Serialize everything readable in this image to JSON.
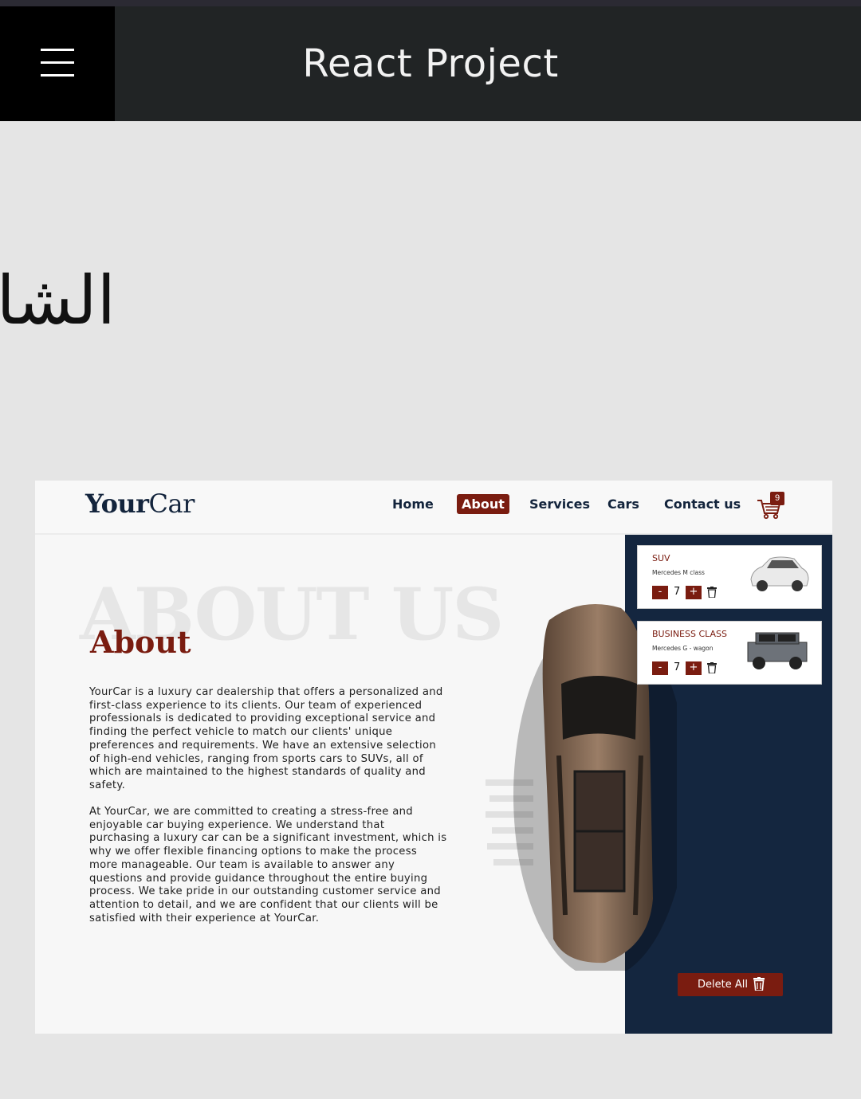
{
  "app": {
    "title": "React Project"
  },
  "arabic_text": "الشا",
  "site": {
    "brand_bold": "Your",
    "brand_regular": "Car",
    "nav": [
      "Home",
      "About",
      "Services",
      "Cars",
      "Contact us"
    ],
    "active_nav": "About",
    "cart_count": "9",
    "ghost_heading": "ABOUT US",
    "heading": "About",
    "paragraph1": "YourCar is a luxury car dealership that offers a personalized and first-class experience to its clients. Our team of experienced professionals is dedicated to providing exceptional service and finding the perfect vehicle to match our clients' unique preferences and requirements. We have an extensive selection of high-end vehicles, ranging from sports cars to SUVs, all of which are maintained to the highest standards of quality and safety.",
    "paragraph2": "At YourCar, we are committed to creating a stress-free and enjoyable car buying experience. We understand that purchasing a luxury car can be a significant investment, which is why we offer flexible financing options to make the process more manageable. Our team is available to answer any questions and provide guidance throughout the entire buying process. We take pride in our outstanding customer service and attention to detail, and we are confident that our clients will be satisfied with their experience at YourCar.",
    "cart_items": [
      {
        "title": "SUV",
        "subtitle": "Mercedes M class",
        "qty": "7",
        "minus": "-",
        "plus": "+"
      },
      {
        "title": "BUSINESS CLASS",
        "subtitle": "Mercedes G - wagon",
        "qty": "7",
        "minus": "-",
        "plus": "+"
      }
    ],
    "delete_all": "Delete All"
  },
  "colors": {
    "accent": "#7a1c10",
    "navy": "#14263f",
    "appbar": "#212425"
  }
}
